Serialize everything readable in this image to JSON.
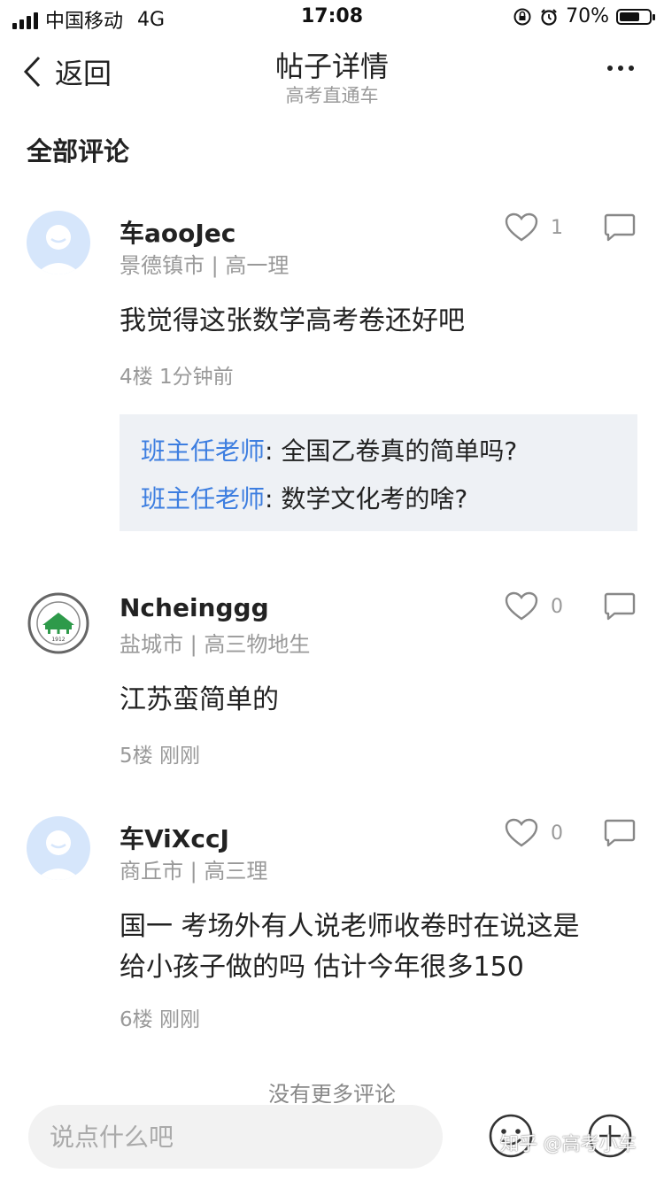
{
  "status_bar": {
    "carrier": "中国移动",
    "network": "4G",
    "time": "17:08",
    "battery": "70%",
    "battery_level": 0.7
  },
  "nav": {
    "back_label": "返回",
    "title": "帖子详情",
    "subtitle": "高考直通车"
  },
  "section_title": "全部评论",
  "comments": [
    {
      "username": "车aooJec",
      "location": "景德镇市",
      "grade": "高一理",
      "likes": "1",
      "text": "我觉得这张数学高考卷还好吧",
      "floor": "4楼",
      "time": "1分钟前",
      "replies": [
        {
          "author": "班主任老师",
          "text": "全国乙卷真的简单吗?"
        },
        {
          "author": "班主任老师",
          "text": "数学文化考的啥?"
        }
      ]
    },
    {
      "username": "Ncheinggg",
      "location": "盐城市",
      "grade": "高三物地生",
      "likes": "0",
      "text": "江苏蛮简单的",
      "floor": "5楼",
      "time": "刚刚",
      "avatar_year": "1912"
    },
    {
      "username": "车ViXccJ",
      "location": "商丘市",
      "grade": "高三理",
      "likes": "0",
      "text_lines": [
        "国一 考场外有人说老师收卷时在说这是",
        "给小孩子做的吗 估计今年很多150"
      ],
      "floor": "6楼",
      "time": "刚刚"
    }
  ],
  "no_more": "没有更多评论",
  "bottom": {
    "input_placeholder": "说点什么吧"
  },
  "watermark": "知乎 @高考小车",
  "colors": {
    "accent_blue": "#3d7ee0",
    "reply_bg": "#eef1f5",
    "meta_gray": "#999999",
    "avatar_bg": "#d6e6fb"
  }
}
